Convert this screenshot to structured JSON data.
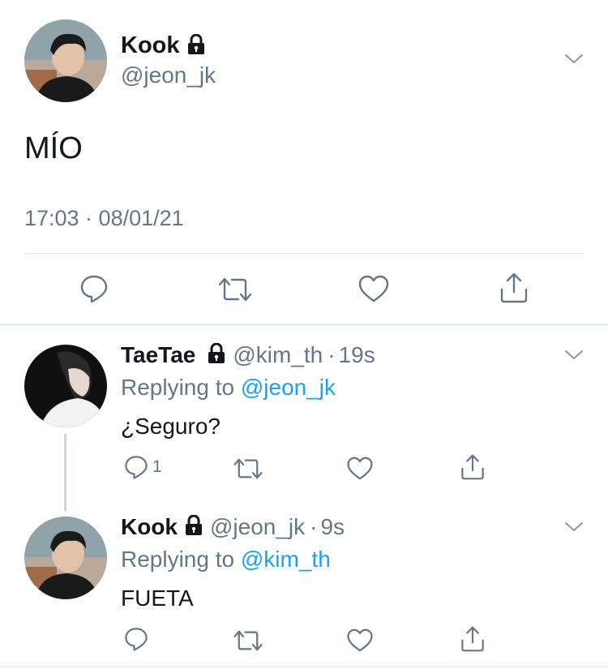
{
  "main_tweet": {
    "name": "Kook",
    "handle": "@jeon_jk",
    "text": "MÍO",
    "timestamp": "17:03 · 08/01/21"
  },
  "replies": [
    {
      "name": "TaeTae",
      "handle": "@kim_th",
      "time": "19s",
      "replying_prefix": "Replying to",
      "replying_to": "@jeon_jk",
      "text": "¿Seguro?",
      "reply_count": "1"
    },
    {
      "name": "Kook",
      "handle": "@jeon_jk",
      "time": "9s",
      "replying_prefix": "Replying to",
      "replying_to": "@kim_th",
      "text": "FUETA"
    }
  ],
  "icons": {
    "lock": "lock-icon",
    "chevron": "chevron-down-icon",
    "reply": "reply-icon",
    "retweet": "retweet-icon",
    "like": "heart-icon",
    "share": "share-icon"
  },
  "colors": {
    "accent": "#1da1f2",
    "muted": "#657786",
    "text": "#14171a",
    "divider": "#e1e8ed"
  }
}
